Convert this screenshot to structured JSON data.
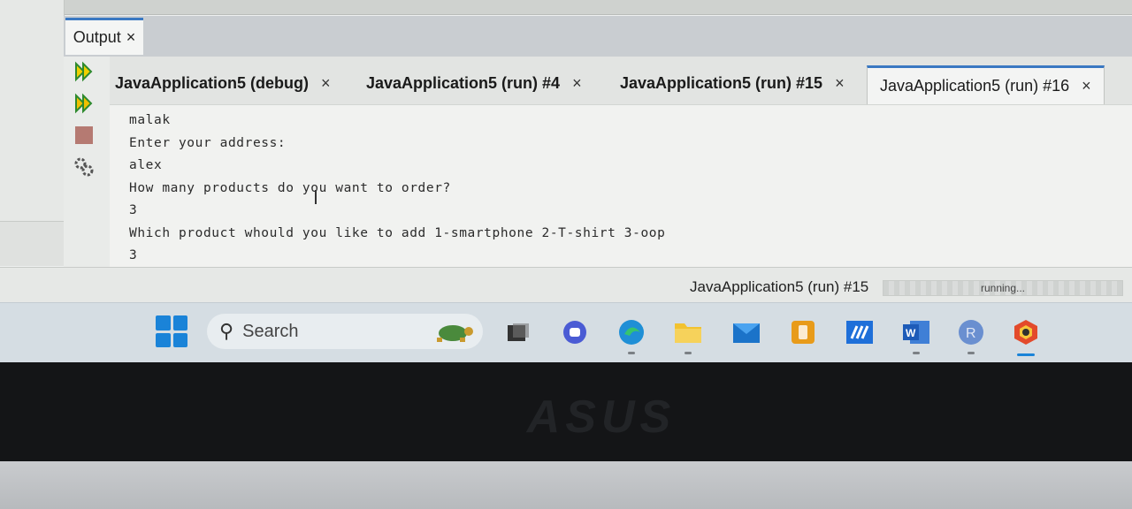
{
  "output_panel": {
    "tab_label": "Output",
    "tab_close": "×"
  },
  "run_tabs": [
    {
      "label": "JavaApplication5 (debug)",
      "close": "×",
      "active": false
    },
    {
      "label": "JavaApplication5 (run) #4",
      "close": "×",
      "active": false
    },
    {
      "label": "JavaApplication5 (run) #15",
      "close": "×",
      "active": false
    },
    {
      "label": "JavaApplication5 (run) #16",
      "close": "×",
      "active": true
    }
  ],
  "console_lines": [
    "malak",
    "Enter your address:",
    "alex",
    "How many products do you want to order?",
    "3",
    "Which product whould you like to add 1-smartphone 2-T-shirt 3-oop",
    "3"
  ],
  "status": {
    "task": "JavaApplication5 (run) #15",
    "progress_label": "running..."
  },
  "taskbar": {
    "search_placeholder": "Search",
    "icons": [
      "start-icon",
      "task-view-icon",
      "chat-icon",
      "edge-icon",
      "file-explorer-icon",
      "mail-icon",
      "office-icon",
      "store-icon",
      "word-icon",
      "r-icon",
      "security-icon"
    ]
  },
  "bezel": {
    "brand": "ASUS"
  },
  "colors": {
    "accent": "#3a78c2",
    "windows_blue": "#1a83d8"
  }
}
